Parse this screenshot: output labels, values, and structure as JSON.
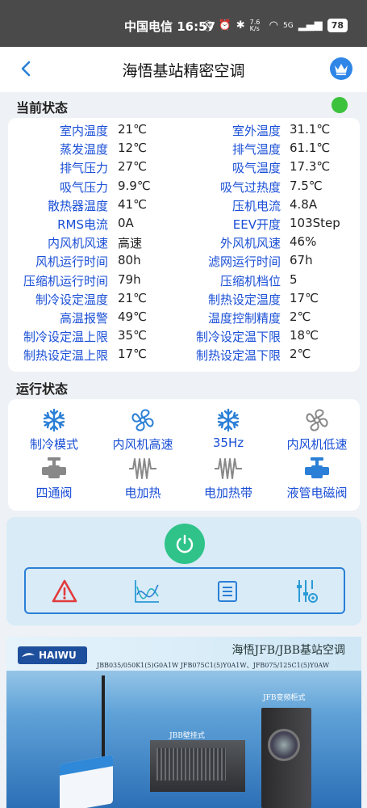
{
  "statusbar": {
    "carrier_time": "中国电信 16:57",
    "net_speed": "7.6 K/s",
    "signal": "5G",
    "battery": "78"
  },
  "header": {
    "title": "海悟基站精密空调",
    "back_icon": "chevron-left-icon",
    "vip_icon": "crown-icon"
  },
  "current_status": {
    "heading": "当前状态",
    "indicator_color": "#3cc23c",
    "rows": [
      {
        "k1": "室内温度",
        "v1": "21℃",
        "k2": "室外温度",
        "v2": "31.1℃"
      },
      {
        "k1": "蒸发温度",
        "v1": "12℃",
        "k2": "排气温度",
        "v2": "61.1℃"
      },
      {
        "k1": "排气压力",
        "v1": "27℃",
        "k2": "吸气温度",
        "v2": "17.3℃"
      },
      {
        "k1": "吸气压力",
        "v1": "9.9℃",
        "k2": "吸气过热度",
        "v2": "7.5℃"
      },
      {
        "k1": "散热器温度",
        "v1": "41℃",
        "k2": "压机电流",
        "v2": "4.8A"
      },
      {
        "k1": "RMS电流",
        "v1": "0A",
        "k2": "EEV开度",
        "v2": "103Step"
      },
      {
        "k1": "内风机风速",
        "v1": "高速",
        "k2": "外风机风速",
        "v2": "46%"
      },
      {
        "k1": "风机运行时间",
        "v1": "80h",
        "k2": "滤网运行时间",
        "v2": "67h"
      },
      {
        "k1": "压缩机运行时间",
        "v1": "79h",
        "k2": "压缩机档位",
        "v2": "5"
      },
      {
        "k1": "制冷设定温度",
        "v1": "21℃",
        "k2": "制热设定温度",
        "v2": "17℃"
      },
      {
        "k1": "高温报警",
        "v1": "49℃",
        "k2": "温度控制精度",
        "v2": "2℃"
      },
      {
        "k1": "制冷设定温上限",
        "v1": "35℃",
        "k2": "制冷设定温下限",
        "v2": "18℃"
      },
      {
        "k1": "制热设定温上限",
        "v1": "17℃",
        "k2": "制热设定温下限",
        "v2": "2℃"
      }
    ]
  },
  "running_status": {
    "heading": "运行状态",
    "items": [
      {
        "label": "制冷模式",
        "icon": "snowflake-icon",
        "active": true
      },
      {
        "label": "内风机高速",
        "icon": "fan-icon",
        "active": true
      },
      {
        "label": "35Hz",
        "icon": "snowflake-icon",
        "active": true
      },
      {
        "label": "内风机低速",
        "icon": "fan-icon",
        "active": false
      },
      {
        "label": "四通阀",
        "icon": "valve-icon",
        "active": false
      },
      {
        "label": "电加热",
        "icon": "heater-coil-icon",
        "active": false
      },
      {
        "label": "电加热带",
        "icon": "heater-coil-icon",
        "active": false
      },
      {
        "label": "液管电磁阀",
        "icon": "valve-icon",
        "active": true
      }
    ]
  },
  "controls": {
    "power_icon": "power-icon",
    "tools": [
      "alarm-warning-icon",
      "curve-chart-icon",
      "list-document-icon",
      "settings-sliders-icon"
    ]
  },
  "banner": {
    "logo": "HAIWU",
    "title": "海悟JFB/JBB基站空调",
    "models": "JBB035/050K1(5)G0A1W   JFB075C1(5)Y0A1W、JFB075/125C1(5)Y0AW",
    "caption_floor": "JFB变频柜式",
    "caption_wall": "JBB壁挂式"
  },
  "colors": {
    "accent": "#1a4fd6",
    "active_icon": "#2b7fd6",
    "inactive_icon": "#888888",
    "power": "#2fc38a",
    "alarm": "#e23b3b"
  }
}
